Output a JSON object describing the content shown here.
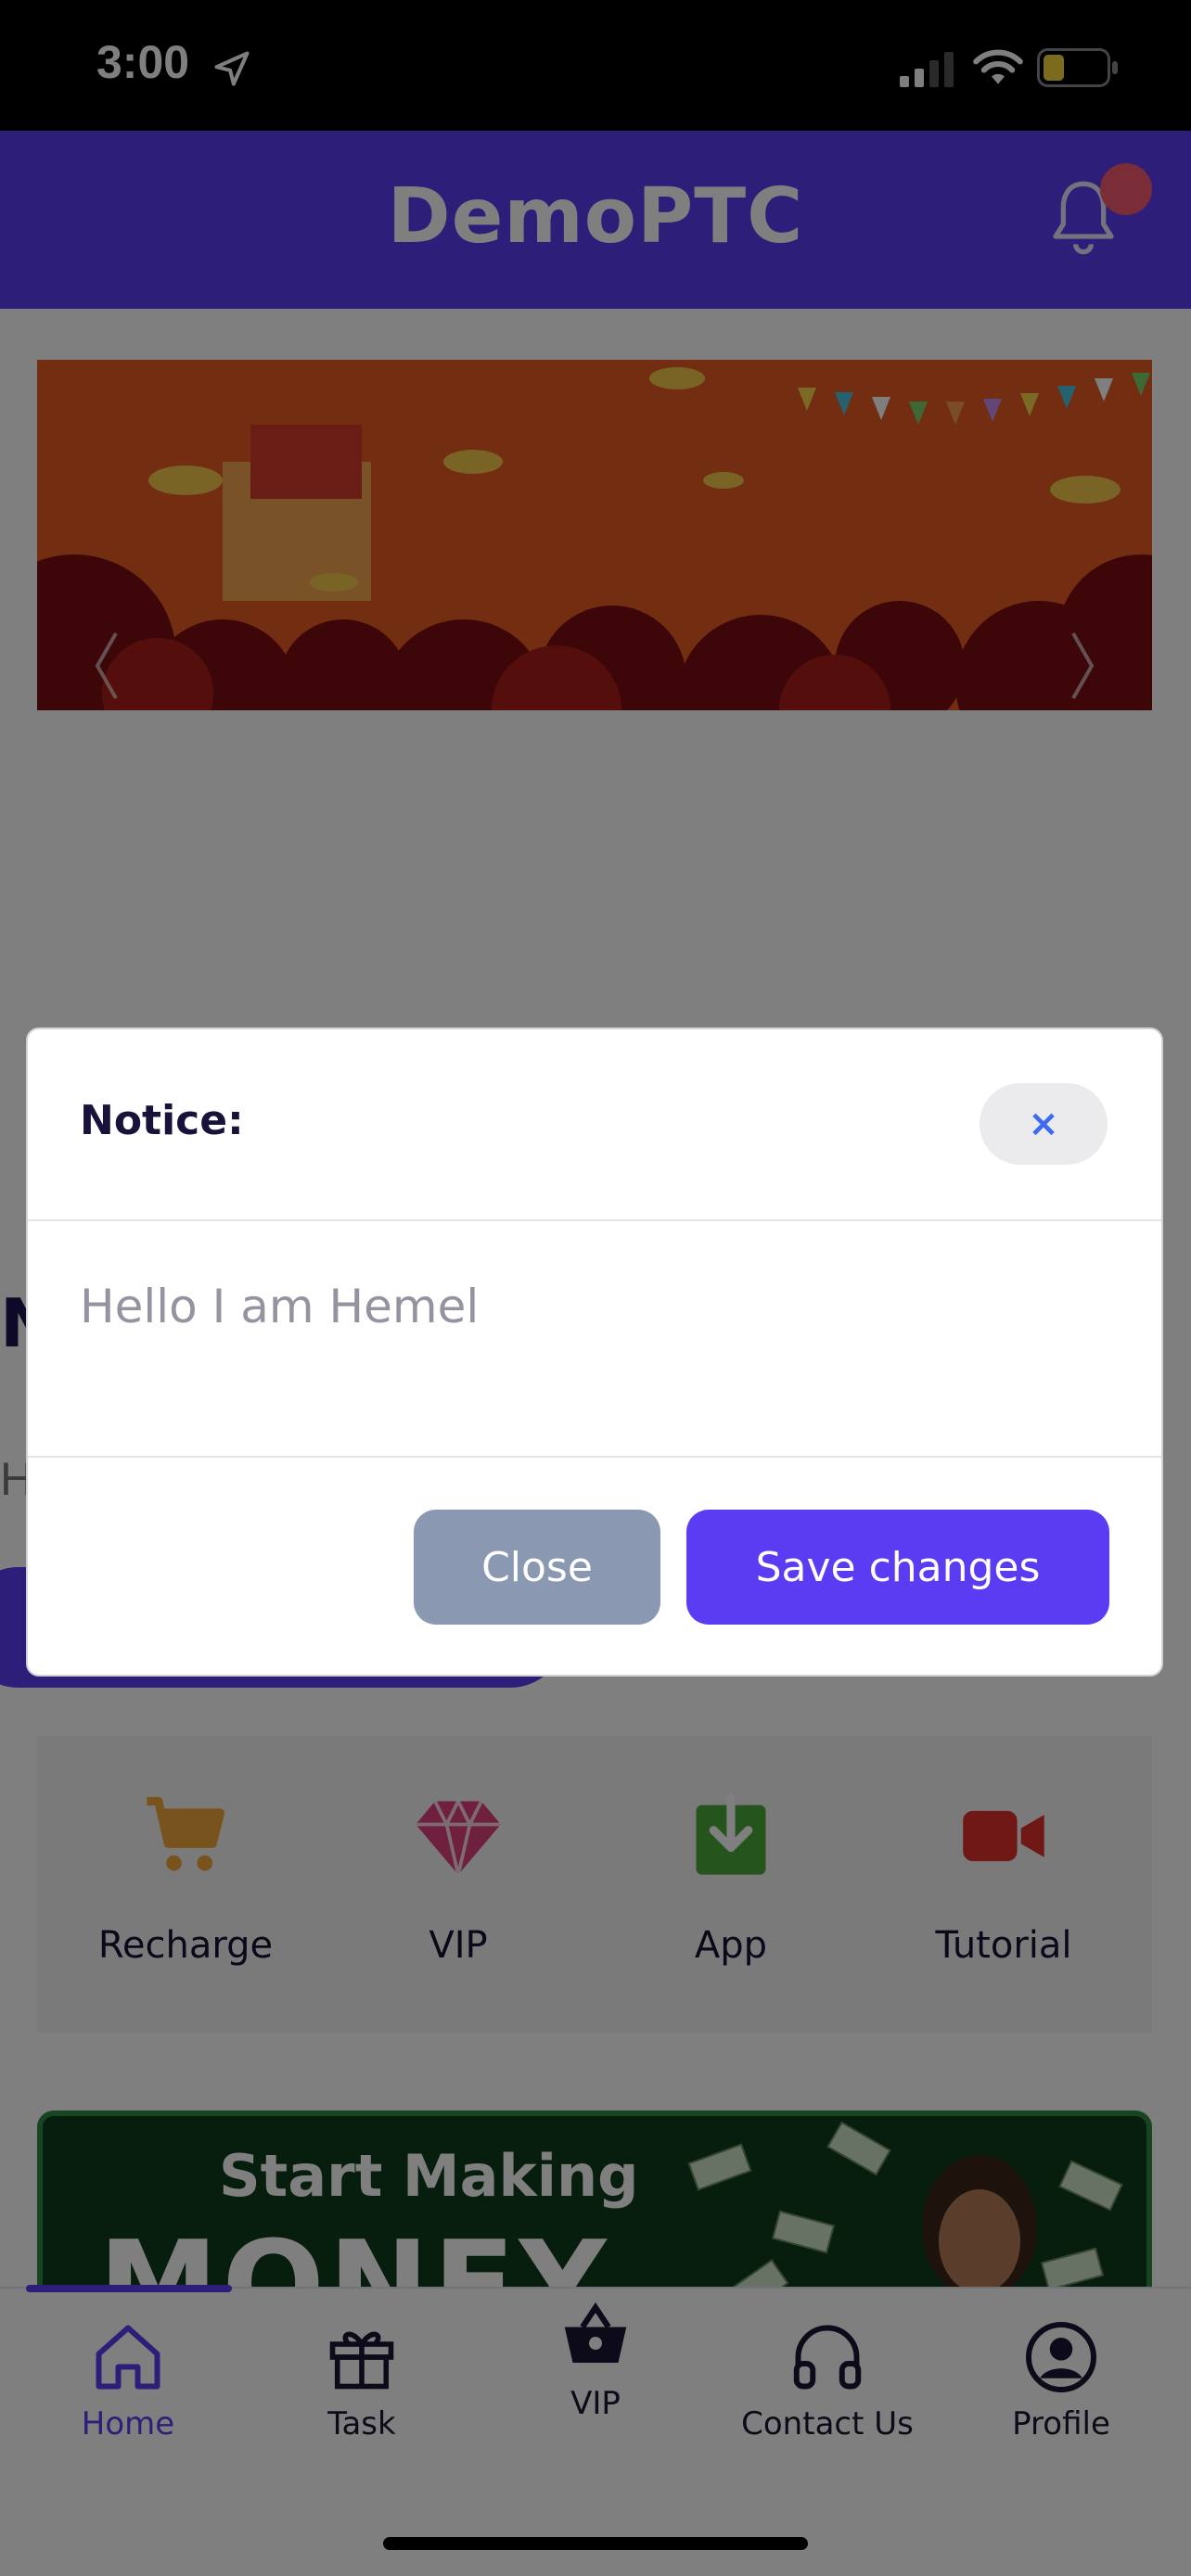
{
  "status_bar": {
    "time": "3:00",
    "icons": [
      "location-arrow-icon",
      "cellular-signal-icon",
      "wifi-icon",
      "battery-icon"
    ]
  },
  "header": {
    "brand": "DemoPTC",
    "notification_icon": "bell-icon"
  },
  "colors": {
    "brand": "#5b3cf2",
    "close_button": "#8a99b1",
    "overlay": "rgba(0,0,0,0.5)"
  },
  "page": {
    "partial_title": "N",
    "partial_subtitle": "H",
    "quick_actions": [
      {
        "label": "Recharge",
        "icon": "cart-icon"
      },
      {
        "label": "VIP",
        "icon": "diamond-icon"
      },
      {
        "label": "App",
        "icon": "download-icon"
      },
      {
        "label": "Tutorial",
        "icon": "video-camera-icon"
      }
    ],
    "promo_banner": {
      "line1": "Start Making",
      "line2": "MONEY"
    }
  },
  "bottom_nav": {
    "items": [
      {
        "label": "Home",
        "icon": "home-icon",
        "active": true
      },
      {
        "label": "Task",
        "icon": "gift-icon",
        "active": false
      },
      {
        "label": "VIP",
        "icon": "basket-icon",
        "active": false
      },
      {
        "label": "Contact Us",
        "icon": "headphones-icon",
        "active": false
      },
      {
        "label": "Profile",
        "icon": "user-circle-icon",
        "active": false
      }
    ]
  },
  "modal": {
    "title": "Notice:",
    "close_x": "×",
    "body": "Hello I am Hemel",
    "close_label": "Close",
    "save_label": "Save changes"
  }
}
